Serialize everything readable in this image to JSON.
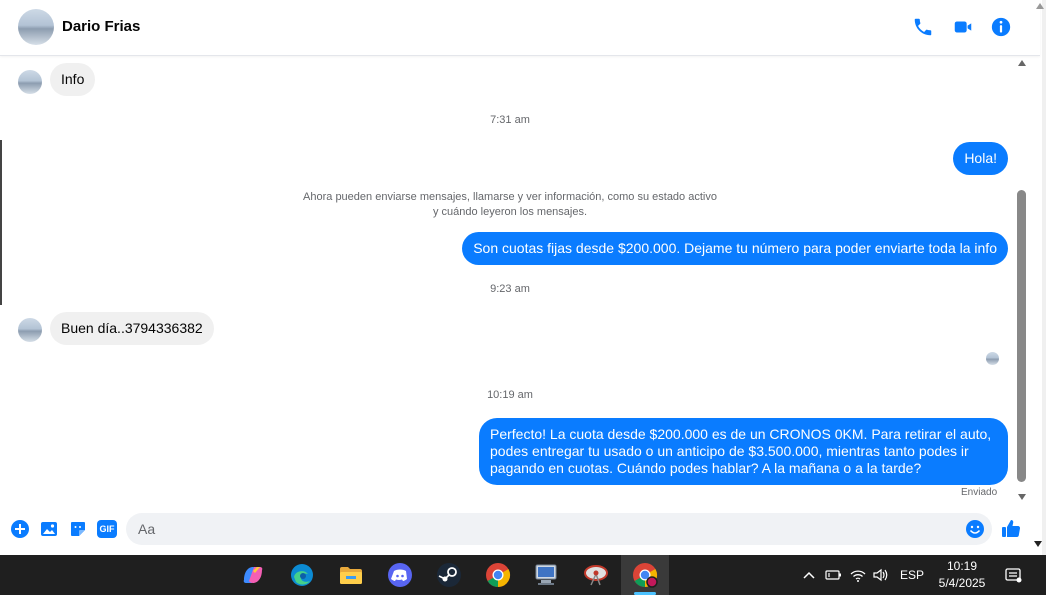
{
  "header": {
    "contact_name": "Dario Frias",
    "icons": [
      "phone-icon",
      "video-camera-icon",
      "info-icon"
    ]
  },
  "messages": {
    "m1_text": "Info",
    "t1": "7:31 am",
    "m2_text": "Hola!",
    "system_line1": "Ahora pueden enviarse mensajes, llamarse y ver información, como su estado activo",
    "system_line2": "y cuándo leyeron los mensajes.",
    "m3_text": "Son cuotas fijas desde $200.000. Dejame tu número para poder enviarte toda la info",
    "t2": "9:23 am",
    "m4_text": "Buen día..3794336382",
    "t3": "10:19 am",
    "m5_text": "Perfecto! La cuota desde $200.000 es de un CRONOS 0KM. Para retirar el auto, podes entregar tu usado o un anticipo de $3.500.000, mientras tanto podes ir pagando en cuotas. Cuándo podes hablar? A la mañana o a la tarde?",
    "status": "Enviado"
  },
  "composer": {
    "placeholder": "Aa",
    "gif_label": "GIF",
    "icons": [
      "plus-icon",
      "image-icon",
      "sticker-icon",
      "gif-icon",
      "emoji-icon",
      "thumbs-up-icon"
    ]
  },
  "taskbar": {
    "apps": [
      "copilot-icon",
      "edge-icon",
      "file-explorer-icon",
      "discord-icon",
      "steam-icon",
      "chrome-icon",
      "network-app-icon",
      "satellite-app-icon",
      "chrome-profile-icon"
    ],
    "language": "ESP",
    "time": "10:19",
    "date": "5/4/2025"
  },
  "colors": {
    "accent": "#0a7cff",
    "incoming_bubble": "#f0f0f0",
    "taskbar": "#1f1f1f"
  }
}
